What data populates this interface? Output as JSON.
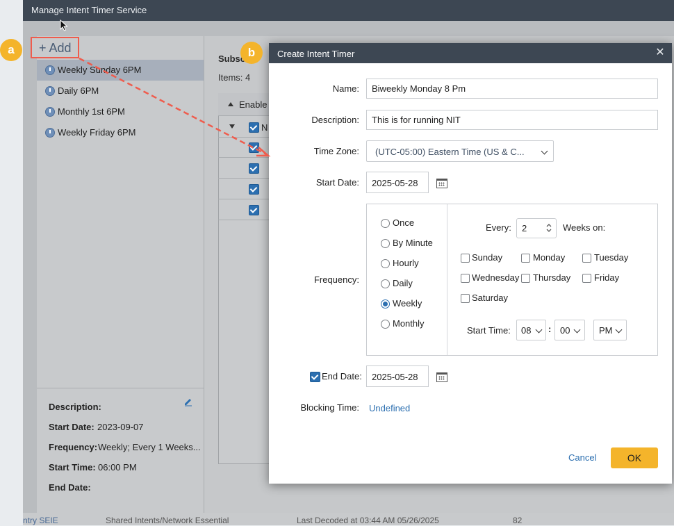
{
  "manage_window": {
    "title": "Manage Intent Timer Service"
  },
  "left_panel": {
    "add_label": "+ Add",
    "timers": [
      {
        "label": "Weekly Sunday 6PM",
        "selected": true
      },
      {
        "label": "Daily 6PM"
      },
      {
        "label": "Monthly 1st 6PM"
      },
      {
        "label": "Weekly Friday 6PM"
      }
    ],
    "details": {
      "description_label": "Description:",
      "start_date_label": "Start Date:",
      "start_date_value": "2023-09-07",
      "frequency_label": "Frequency:",
      "frequency_value": "Weekly; Every 1 Weeks...",
      "start_time_label": "Start Time:",
      "start_time_value": "06:00 PM",
      "end_date_label": "End Date:"
    }
  },
  "right_panel": {
    "subscr_partial": "Subsc",
    "items_label": "Items: 4",
    "enable_col_partial": "Enable",
    "group_row_partial": "N"
  },
  "footer_strip": {
    "col1": "ntry SEIE",
    "col2": "Shared Intents/Network Essential",
    "col3": "Last Decoded at 03:44 AM 05/26/2025",
    "col4": "82"
  },
  "annotations": {
    "a": "a",
    "b": "b",
    "accent": "#f4b42b",
    "highlight": "#ef5c4d"
  },
  "dialog": {
    "title": "Create Intent Timer",
    "close_icon": "close-icon",
    "name_label": "Name:",
    "name_value": "Biweekly Monday 8 Pm",
    "description_label": "Description:",
    "description_value": "This is for running NIT",
    "timezone_label": "Time Zone:",
    "timezone_value": "(UTC-05:00) Eastern Time (US & C...",
    "start_date_label": "Start Date:",
    "start_date_value": "2025-05-28",
    "frequency_label": "Frequency:",
    "frequency_options": [
      "Once",
      "By Minute",
      "Hourly",
      "Daily",
      "Weekly",
      "Monthly"
    ],
    "frequency_selected": "Weekly",
    "every_label": "Every:",
    "every_value": "2",
    "weeks_on_label": "Weeks on:",
    "days": [
      "Sunday",
      "Monday",
      "Tuesday",
      "Wednesday",
      "Thursday",
      "Friday",
      "Saturday"
    ],
    "start_time_label": "Start Time:",
    "start_hour": "08",
    "time_sep": ":",
    "start_minute": "00",
    "start_ampm": "PM",
    "end_date_label": "End Date:",
    "end_date_checked": true,
    "end_date_value": "2025-05-28",
    "blocking_time_label": "Blocking Time:",
    "blocking_time_value": "Undefined",
    "cancel_label": "Cancel",
    "ok_label": "OK"
  }
}
